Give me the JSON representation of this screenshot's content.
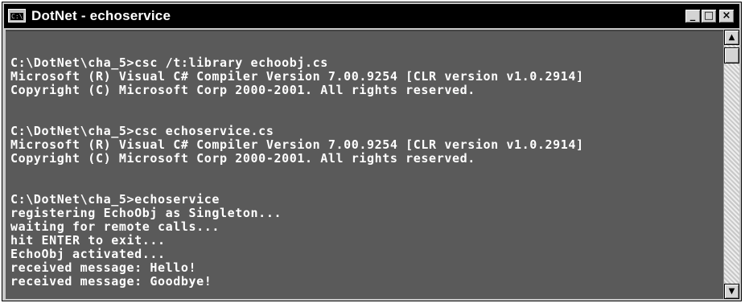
{
  "window": {
    "title": "DotNet - echoservice",
    "icon_label": "C:\\"
  },
  "caption_buttons": {
    "minimize": "_",
    "maximize": "□",
    "close": "×"
  },
  "scrollbar": {
    "up_arrow": "▲",
    "down_arrow": "▼"
  },
  "console": {
    "lines": [
      "",
      "C:\\DotNet\\cha_5>csc /t:library echoobj.cs",
      "Microsoft (R) Visual C# Compiler Version 7.00.9254 [CLR version v1.0.2914]",
      "Copyright (C) Microsoft Corp 2000-2001. All rights reserved.",
      "",
      "",
      "C:\\DotNet\\cha_5>csc echoservice.cs",
      "Microsoft (R) Visual C# Compiler Version 7.00.9254 [CLR version v1.0.2914]",
      "Copyright (C) Microsoft Corp 2000-2001. All rights reserved.",
      "",
      "",
      "C:\\DotNet\\cha_5>echoservice",
      "registering EchoObj as Singleton...",
      "waiting for remote calls...",
      "hit ENTER to exit...",
      "EchoObj activated...",
      "received message: Hello!",
      "received message: Goodbye!",
      ""
    ]
  }
}
